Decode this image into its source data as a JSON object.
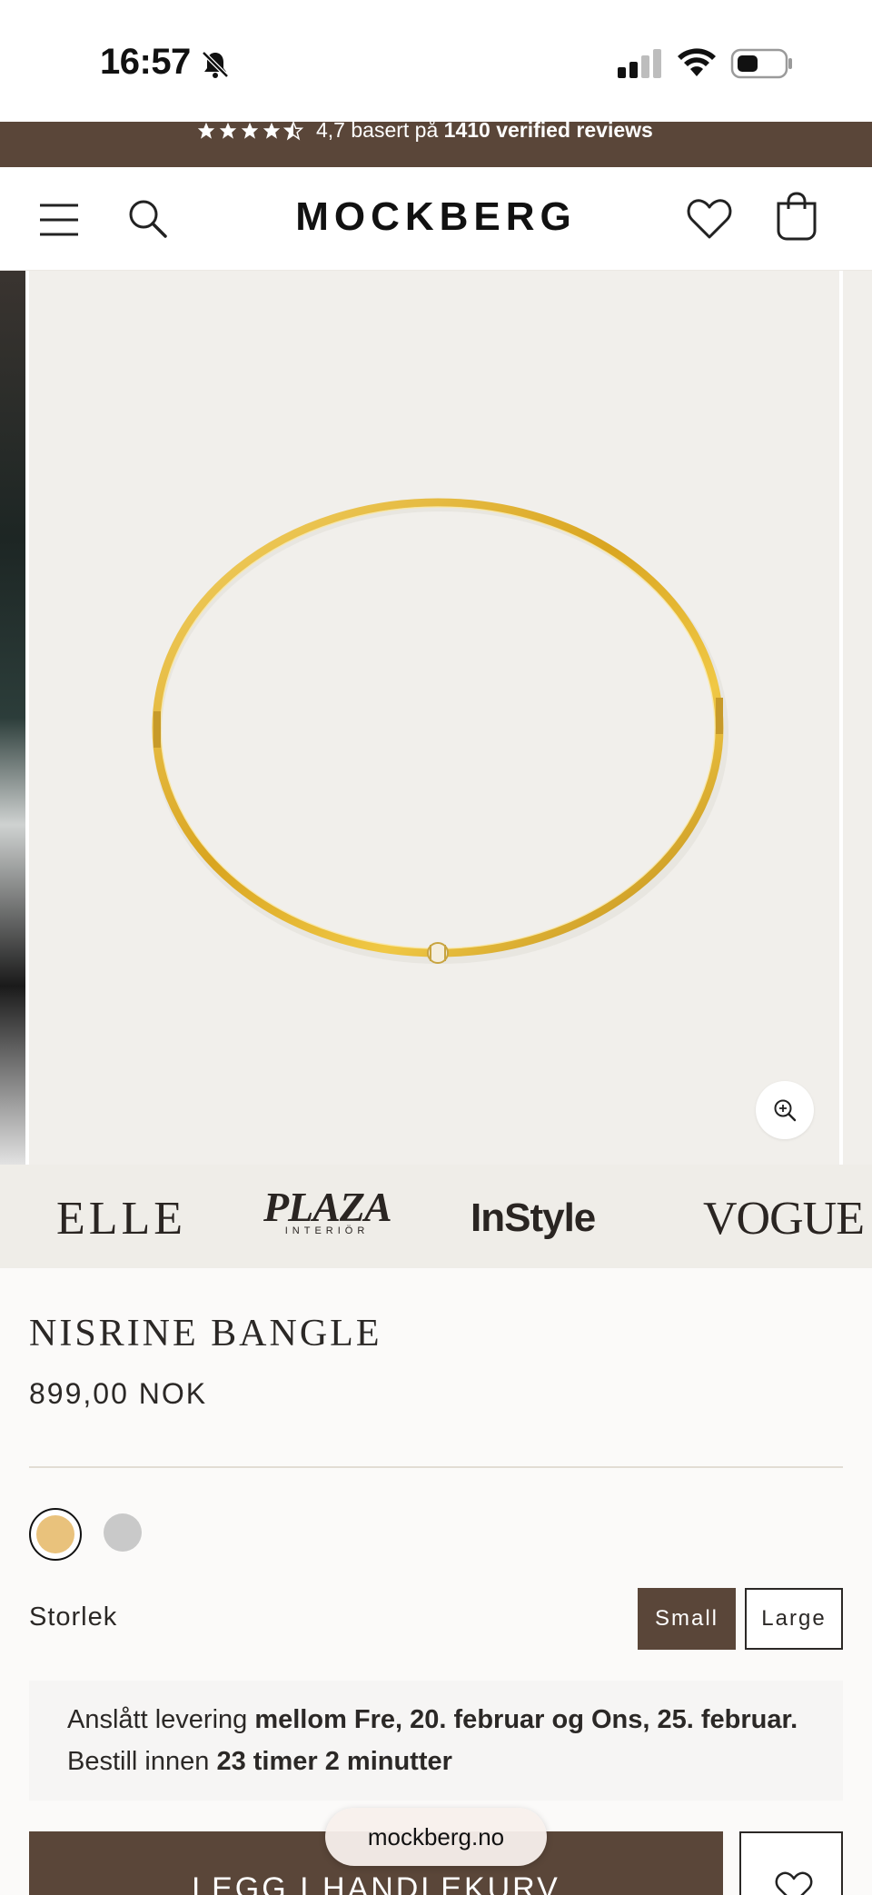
{
  "status_bar": {
    "time": "16:57",
    "icons": [
      "bell-slash-icon",
      "cellular-signal-icon",
      "wifi-icon",
      "battery-icon"
    ]
  },
  "review_banner": {
    "rating_stars": 4.5,
    "rating_text": "4,7 basert på",
    "reviews_text": "1410 verified reviews"
  },
  "header": {
    "logo": "MOCKBERG",
    "icons": [
      "menu-icon",
      "search-icon",
      "heart-icon",
      "bag-icon"
    ]
  },
  "gallery": {
    "image_alt": "bangle-product-image",
    "zoom_icon": "zoom-in-icon"
  },
  "press": {
    "elle": "ELLE",
    "plaza": "PLAZA",
    "plaza_sub": "INTERIÖR",
    "instyle": "InStyle",
    "vogue": "VOGUE"
  },
  "product": {
    "title": "NISRINE BANGLE",
    "price": "899,00 NOK",
    "colors": [
      {
        "name": "gold",
        "hex": "#e9c27c",
        "selected": true
      },
      {
        "name": "silver",
        "hex": "#c9c9c9",
        "selected": false
      }
    ],
    "size_label": "Storlek",
    "sizes": [
      {
        "label": "Small",
        "selected": true
      },
      {
        "label": "Large",
        "selected": false
      }
    ]
  },
  "delivery": {
    "prefix": "Anslått levering ",
    "dates": "mellom Fre, 20. februar og Ons, 25. februar.",
    "middle": " Bestill innen ",
    "countdown": "23 timer 2 minutter"
  },
  "cart": {
    "add_label": "LEGG I HANDLEKURV",
    "wishlist_icon": "heart-icon"
  },
  "browser": {
    "url": "mockberg.no"
  },
  "colors": {
    "brand_brown": "#5a4639",
    "gallery_bg": "#f1efeb",
    "press_bg": "#efede8"
  }
}
